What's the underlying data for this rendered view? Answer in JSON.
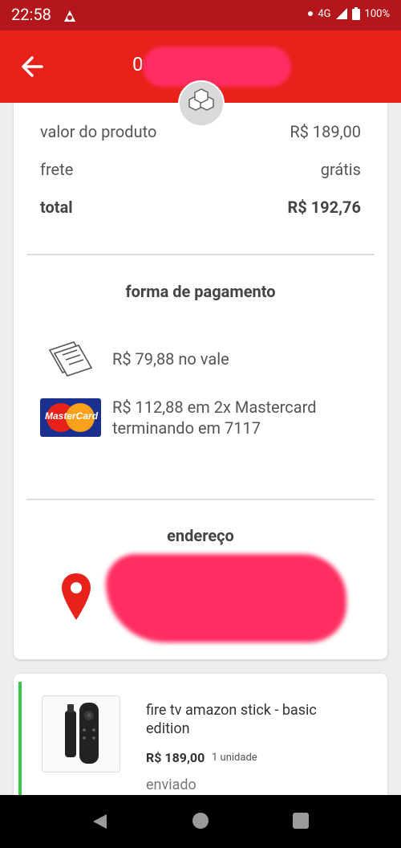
{
  "status_bar": {
    "time": "22:58",
    "network": "4G",
    "battery": "100%"
  },
  "header": {
    "title": "0"
  },
  "summary": {
    "product_label": "valor do produto",
    "product_value": "R$ 189,00",
    "shipping_label": "frete",
    "shipping_value": "grátis",
    "total_label": "total",
    "total_value": "R$ 192,76"
  },
  "payment": {
    "title": "forma de pagamento",
    "voucher_text": "R$ 79,88 no vale",
    "card_brand": "MasterCard",
    "card_line1": "R$ 112,88 em 2x Mastercard",
    "card_line2": "terminando em 7117"
  },
  "address": {
    "title": "endereço"
  },
  "product": {
    "title": "fire tv amazon stick - basic edition",
    "price": "R$ 189,00",
    "quantity": "1 unidade",
    "status": "enviado"
  },
  "colors": {
    "primary": "#e8221b",
    "status_bar": "#b3161b",
    "shipped": "#39c44a"
  }
}
